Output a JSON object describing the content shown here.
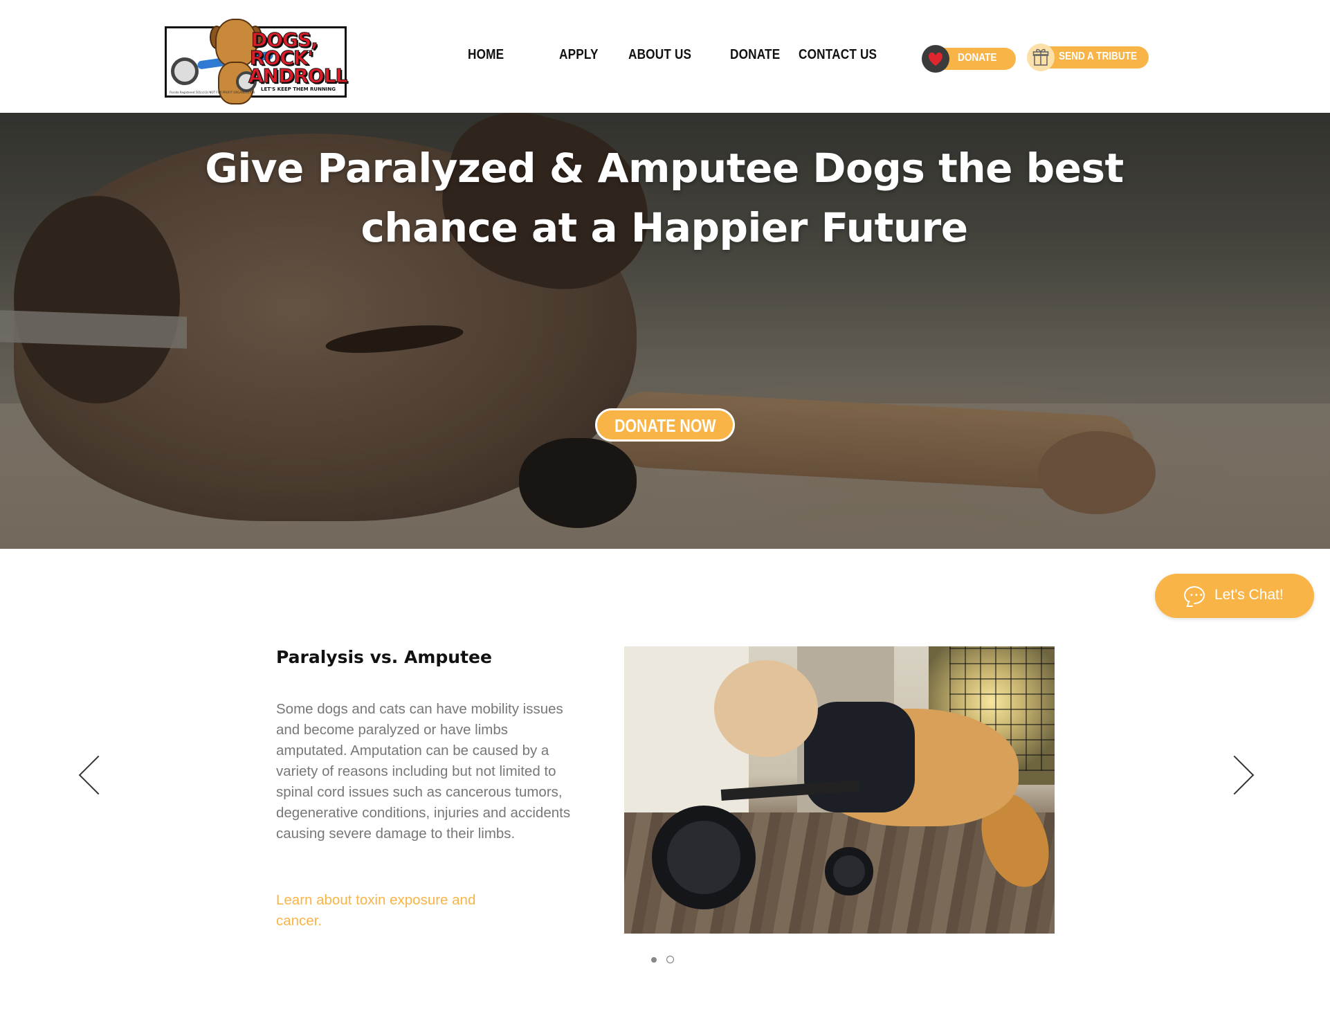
{
  "header": {
    "logo": {
      "line1": "DOGS,",
      "line2": "ROCK'",
      "line3": "ANDROLL",
      "tagline": "LET'S KEEP THEM RUNNING",
      "fine_print": "Florida Registered 501(c)(3) NOT FOR PROFIT ORGANIZATION"
    },
    "nav": [
      {
        "label": "HOME"
      },
      {
        "label": "APPLY"
      },
      {
        "label": "ABOUT US"
      },
      {
        "label": "DONATE"
      },
      {
        "label": "CONTACT US"
      }
    ],
    "donate_button": {
      "label": "DONATE",
      "icon": "heart-icon"
    },
    "tribute_button": {
      "label": "SEND A TRIBUTE",
      "icon": "gift-icon"
    }
  },
  "hero": {
    "title": "Give Paralyzed & Amputee Dogs the best chance at a Happier Future",
    "cta_label": "DONATE NOW"
  },
  "chat": {
    "label": "Let's Chat!",
    "icon": "chat-bubble-icon"
  },
  "slideshow": {
    "title": "Paralysis vs. Amputee",
    "body": "Some dogs and cats can have mobility issues and become paralyzed or have limbs amputated.  Amputation can be caused by a variety of reasons including but not limited to spinal cord issues such as cancerous tumors, degenerative conditions, injuries and accidents causing severe damage to their limbs.",
    "link": "Learn about toxin exposure and cancer.",
    "prev_icon": "chevron-left-icon",
    "next_icon": "chevron-right-icon",
    "slide_count": 2,
    "active_slide": 1
  },
  "colors": {
    "accent": "#f9b447",
    "text_dark": "#111111",
    "text_muted": "#777777",
    "donate_icon_bg": "#3b3b3b",
    "heart": "#e0262f"
  }
}
